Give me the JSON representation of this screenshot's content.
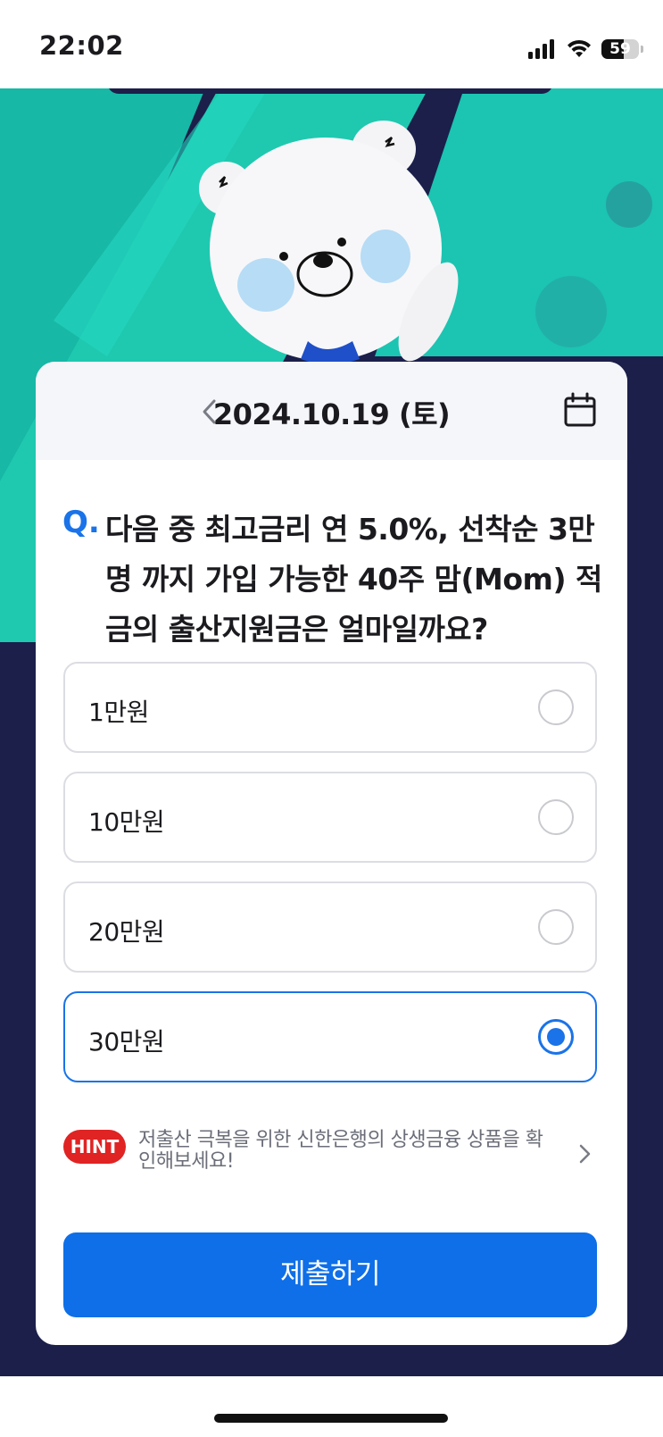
{
  "status_bar": {
    "time": "22:02",
    "battery": "59",
    "battery_level": 0.59,
    "icons": [
      "cellular-signal-icon",
      "wifi-icon",
      "battery-icon"
    ]
  },
  "quiz": {
    "date": "2024.10.19 (토)",
    "question_mark": "Q.",
    "question": "다음 중 최고금리 연 5.0%, 선착순 3만명 까지 가입 가능한 40주 맘(Mom) 적금의 출산지원금은 얼마일까요?",
    "options": [
      {
        "label": "1만원",
        "selected": false
      },
      {
        "label": "10만원",
        "selected": false
      },
      {
        "label": "20만원",
        "selected": false
      },
      {
        "label": "30만원",
        "selected": true
      }
    ],
    "hint_badge": "HINT",
    "hint_text": "저출산 극복을 위한 신한은행의 상생금융 상품을 확인해보세요!",
    "submit_label": "제출하기"
  },
  "colors": {
    "accent": "#0e6fe8",
    "hint_badge": "#e02323",
    "hero_teal": "#1fc9b0",
    "hero_navy": "#1b1f4a"
  }
}
